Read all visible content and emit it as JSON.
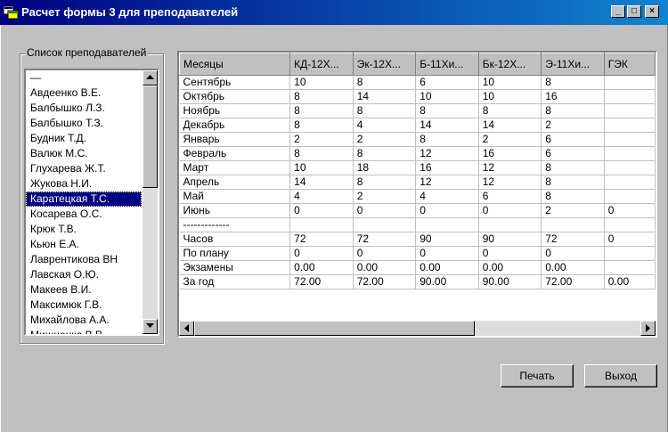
{
  "window": {
    "title": "Расчет формы 3 для преподавателей",
    "minimize": "_",
    "maximize": "□",
    "close": "×"
  },
  "teachers": {
    "label": "Список преподавателей",
    "items": [
      "—",
      "Авдеенко В.Е.",
      "Балбышко Л.З.",
      "Балбышко Т.З.",
      "Будник Т.Д.",
      "Валюк М.С.",
      "Глухарева Ж.Т.",
      "Жукова Н.И.",
      "Каратецкая Т.С.",
      "Косарева О.С.",
      "Крюк Т.В.",
      "Кьюн Е.А.",
      "Лаврентикова ВН",
      "Лавская О.Ю.",
      "Макеев В.И.",
      "Максимюк Г.В.",
      "Михайлова А.А.",
      "Мишненко В.В."
    ],
    "selected": "Каратецкая Т.С."
  },
  "grid": {
    "columns": [
      "Месяцы",
      "КД-12Х...",
      "Эк-12Х...",
      "Б-11Хи...",
      "Бк-12Х...",
      "Э-11Хи...",
      "ГЭК"
    ],
    "rows": [
      [
        "Сентябрь",
        "10",
        "8",
        "6",
        "10",
        "8",
        ""
      ],
      [
        "Октябрь",
        "8",
        "14",
        "10",
        "10",
        "16",
        ""
      ],
      [
        "Ноябрь",
        "8",
        "8",
        "8",
        "8",
        "8",
        ""
      ],
      [
        "Декабрь",
        "8",
        "4",
        "14",
        "14",
        "2",
        ""
      ],
      [
        "Январь",
        "2",
        "2",
        "8",
        "2",
        "6",
        ""
      ],
      [
        "Февраль",
        "8",
        "8",
        "12",
        "16",
        "6",
        ""
      ],
      [
        "Март",
        "10",
        "18",
        "16",
        "12",
        "8",
        ""
      ],
      [
        "Апрель",
        "14",
        "8",
        "12",
        "12",
        "8",
        ""
      ],
      [
        "Май",
        "4",
        "2",
        "4",
        "6",
        "8",
        ""
      ],
      [
        "Июнь",
        "0",
        "0",
        "0",
        "0",
        "2",
        "0"
      ],
      [
        "-------------",
        "",
        "",
        "",
        "",
        "",
        ""
      ],
      [
        "Часов",
        "72",
        "72",
        "90",
        "90",
        "72",
        "0"
      ],
      [
        "По плану",
        "0",
        "0",
        "0",
        "0",
        "0",
        ""
      ],
      [
        "Экзамены",
        "0.00",
        "0.00",
        "0.00",
        "0.00",
        "0.00",
        ""
      ],
      [
        "За год",
        "72.00",
        "72.00",
        "90.00",
        "90.00",
        "72.00",
        "0.00"
      ]
    ]
  },
  "buttons": {
    "print": "Печать",
    "exit": "Выход"
  }
}
